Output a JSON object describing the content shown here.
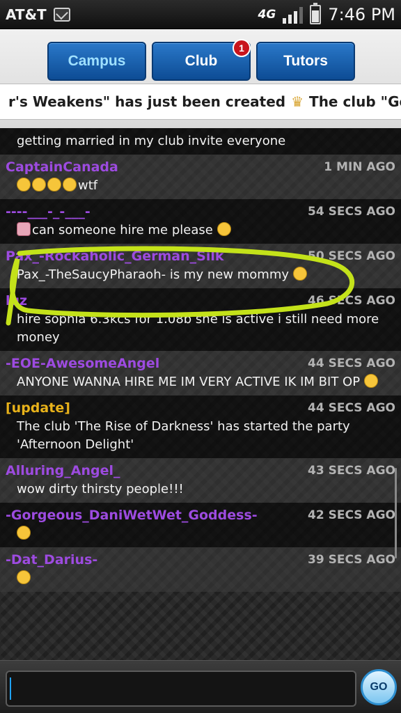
{
  "status_bar": {
    "carrier": "AT&T",
    "network": "4G",
    "time": "7:46 PM",
    "battery_level": 0.7,
    "signal_bars": 3,
    "icons": [
      "message-icon",
      "signal-icon",
      "battery-icon"
    ]
  },
  "tabs": [
    {
      "label": "Campus",
      "active": true
    },
    {
      "label": "Club",
      "active": false,
      "badge": "1"
    },
    {
      "label": "Tutors",
      "active": false
    }
  ],
  "ticker": {
    "text_left": "r's Weakens\" has just been created",
    "text_right": "The club \"Getti"
  },
  "feed": [
    {
      "user": "",
      "time": "",
      "message": "getting married in my club invite everyone",
      "emoji_prefix": 0,
      "emoji_suffix": 0
    },
    {
      "user": "CaptainCanada",
      "time": "1 MIN AGO",
      "message": "wtf",
      "emoji_prefix": 4,
      "emoji_suffix": 0
    },
    {
      "user": "----___-_-___-",
      "time": "54 SECS AGO",
      "message": "can someone hire me please",
      "emoji_prefix": 1,
      "emoji_suffix": 1
    },
    {
      "user": "Pax_-Rockaholic_German_Silk",
      "time": "50 SECS AGO",
      "message": "Pax_-TheSaucyPharaoh- is my new mommy",
      "emoji_prefix": 0,
      "emoji_suffix": 1
    },
    {
      "user": "luz",
      "time": "46 SECS AGO",
      "message": "hire sophia 6.3kcs for 1.08b she is active i still need more money",
      "emoji_prefix": 0,
      "emoji_suffix": 0
    },
    {
      "user": "-EOE-AwesomeAngel",
      "time": "44 SECS AGO",
      "message": "ANYONE WANNA HIRE ME IM VERY ACTIVE IK IM BIT OP",
      "emoji_prefix": 0,
      "emoji_suffix": 1
    },
    {
      "user": "[update]",
      "time": "44 SECS AGO",
      "message": "The club 'The Rise of Darkness' has started the party 'Afternoon Delight'",
      "emoji_prefix": 0,
      "emoji_suffix": 0,
      "kind": "update"
    },
    {
      "user": "Alluring_Angel_",
      "time": "43 SECS AGO",
      "message": "wow dirty thirsty people!!!",
      "emoji_prefix": 0,
      "emoji_suffix": 0
    },
    {
      "user": "-Gorgeous_DaniWetWet_Goddess-",
      "time": "42 SECS AGO",
      "message": "",
      "emoji_prefix": 1,
      "emoji_suffix": 0
    },
    {
      "user": "-Dat_Darius-",
      "time": "39 SECS AGO",
      "message": "",
      "emoji_prefix": 1,
      "emoji_suffix": 0
    }
  ],
  "input": {
    "value": "",
    "placeholder": "",
    "send_label": "GO"
  }
}
